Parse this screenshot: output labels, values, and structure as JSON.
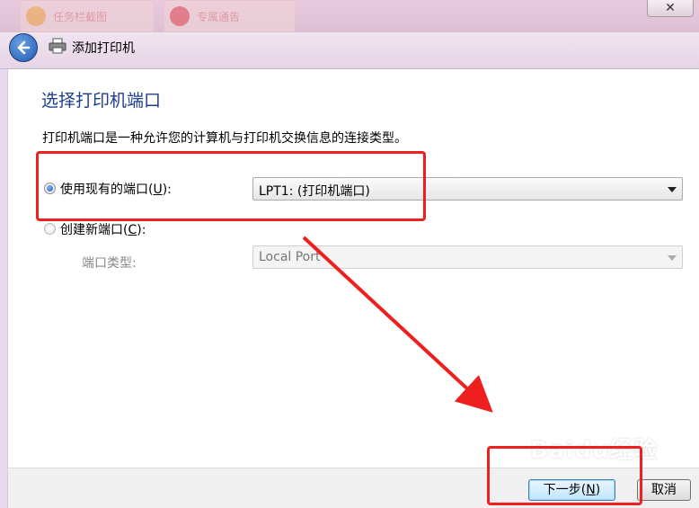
{
  "window": {
    "close_glyph": "✕",
    "background_tabs": [
      {
        "label": "任务栏截图",
        "icon": "orange-cloud-icon"
      },
      {
        "label": "专属通告",
        "icon": "red-person-icon"
      }
    ]
  },
  "nav": {
    "back_icon": "back-arrow-icon",
    "printer_icon": "printer-icon",
    "title": "添加打印机"
  },
  "page": {
    "heading": "选择打印机端口",
    "description": "打印机端口是一种允许您的计算机与打印机交换信息的连接类型。"
  },
  "options": {
    "existing": {
      "label_pre": "使用现有的端口(",
      "accel": "U",
      "label_post": "):",
      "selected": true,
      "value": "LPT1: (打印机端口)"
    },
    "create": {
      "label_pre": "创建新端口(",
      "accel": "C",
      "label_post": "):",
      "selected": false,
      "port_type_label": "端口类型:",
      "port_type_value": "Local Port"
    }
  },
  "footer": {
    "next_pre": "下一步(",
    "next_accel": "N",
    "next_post": ")",
    "cancel": "取消"
  },
  "watermark": "Baidu经验",
  "colors": {
    "annotation": "#ee1f1f",
    "heading": "#1e3e8c",
    "window_frame": "#e8d9ec"
  }
}
